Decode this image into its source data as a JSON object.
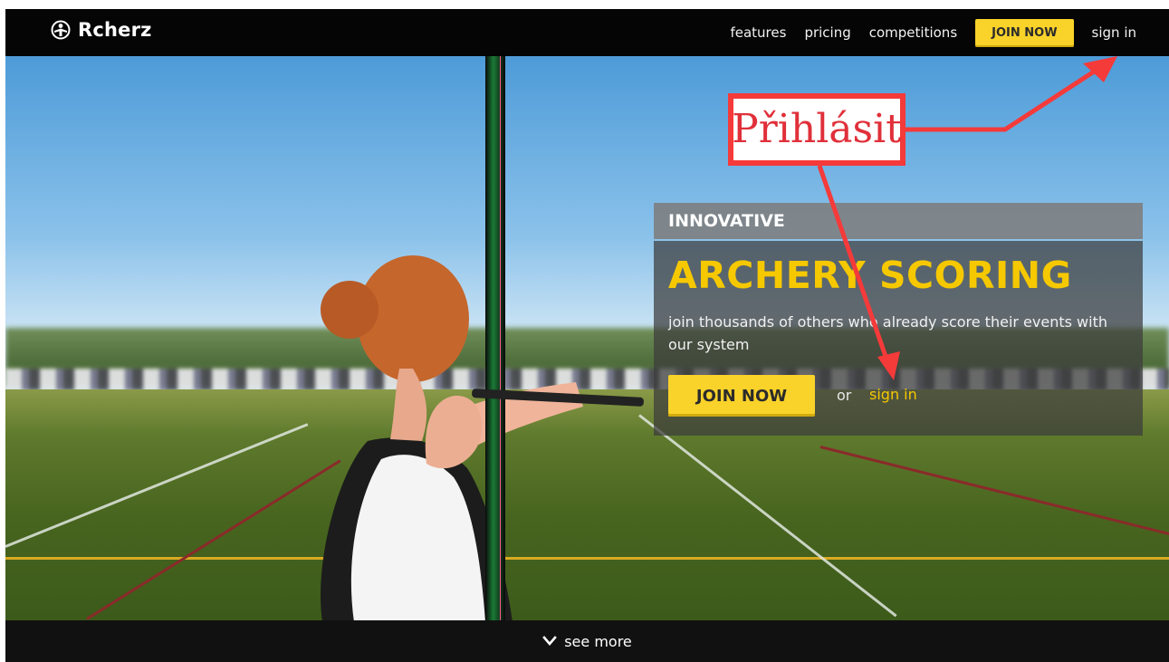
{
  "brand": {
    "name": "Rcherz",
    "logo_icon": "archer-logo-icon"
  },
  "nav": {
    "items": [
      {
        "label": "features"
      },
      {
        "label": "pricing"
      },
      {
        "label": "competitions"
      }
    ],
    "join_label": "JOIN NOW",
    "signin_label": "sign in"
  },
  "hero": {
    "tag": "INNOVATIVE",
    "title": "ARCHERY SCORING",
    "description": "join thousands of others who already score their events with our system",
    "join_label": "JOIN NOW",
    "or_text": "or",
    "signin_label": "sign in"
  },
  "footer": {
    "see_more_label": "see more",
    "icon": "chevron-down-icon"
  },
  "annotation": {
    "text": "Přihlásit",
    "color": "#f53a3a"
  },
  "colors": {
    "accent": "#f9d22a",
    "title_yellow": "#f5c800",
    "nav_bg": "#050505"
  }
}
